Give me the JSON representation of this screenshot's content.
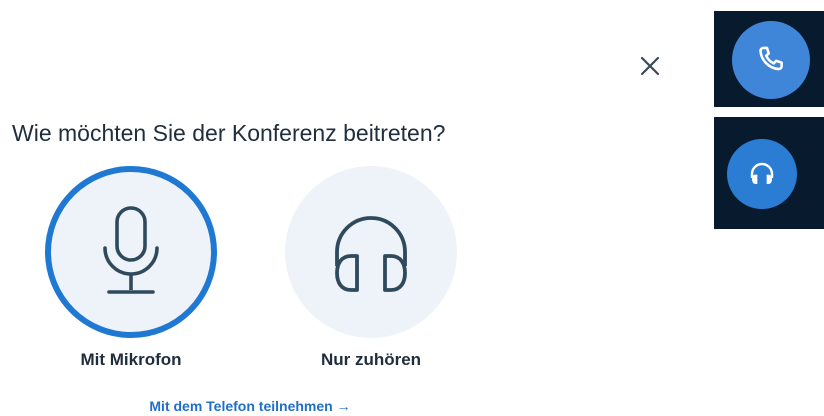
{
  "dialog": {
    "title": "Wie möchten Sie der Konferenz beitreten?",
    "close_icon": "close-icon"
  },
  "options": {
    "microphone": {
      "label": "Mit Mikrofon",
      "icon": "microphone-icon",
      "selected": true
    },
    "listen_only": {
      "label": "Nur zuhören",
      "icon": "headphones-icon",
      "selected": false
    }
  },
  "phone_link": {
    "label": "Mit dem Telefon teilnehmen →"
  },
  "side_buttons": {
    "phone": {
      "icon": "phone-icon"
    },
    "listen": {
      "icon": "headphones-icon"
    }
  },
  "colors": {
    "accent": "#1f79d3",
    "option_bg": "#eef3f9",
    "icon_stroke": "#2f4a5c",
    "side_panel_bg": "#081a2e",
    "side_button": "#2b7cd3",
    "link": "#1f6fc9",
    "text": "#1f2d3d"
  }
}
